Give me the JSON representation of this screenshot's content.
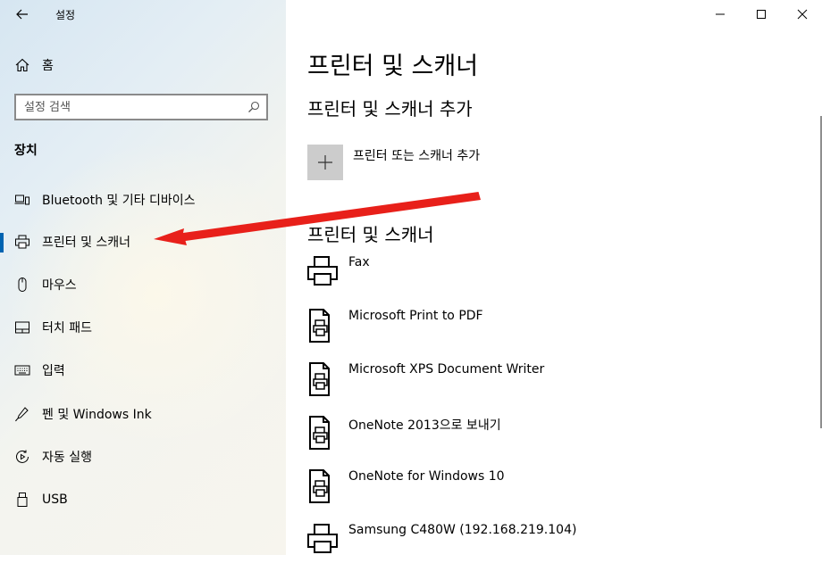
{
  "window": {
    "title": "설정"
  },
  "sidebar": {
    "home_label": "홈",
    "search_placeholder": "설정 검색",
    "section_title": "장치",
    "items": [
      {
        "label": "Bluetooth 및 기타 디바이스",
        "icon": "bluetooth-devices-icon"
      },
      {
        "label": "프린터 및 스캐너",
        "icon": "printer-icon",
        "active": true
      },
      {
        "label": "마우스",
        "icon": "mouse-icon"
      },
      {
        "label": "터치 패드",
        "icon": "touchpad-icon"
      },
      {
        "label": "입력",
        "icon": "keyboard-icon"
      },
      {
        "label": "펜 및 Windows Ink",
        "icon": "pen-icon"
      },
      {
        "label": "자동 실행",
        "icon": "autoplay-icon"
      },
      {
        "label": "USB",
        "icon": "usb-icon"
      }
    ]
  },
  "main": {
    "title": "프린터 및 스캐너",
    "add_section_title": "프린터 및 스캐너 추가",
    "add_button_label": "프린터 또는 스캐너 추가",
    "list_section_title": "프린터 및 스캐너",
    "printers": [
      {
        "name": "Fax",
        "icon": "fax-printer-icon"
      },
      {
        "name": "Microsoft Print to PDF",
        "icon": "document-printer-icon"
      },
      {
        "name": "Microsoft XPS Document Writer",
        "icon": "document-printer-icon"
      },
      {
        "name": "OneNote 2013으로 보내기",
        "icon": "document-printer-icon"
      },
      {
        "name": "OneNote for Windows 10",
        "icon": "document-printer-icon"
      },
      {
        "name": "Samsung C480W (192.168.219.104)",
        "icon": "printer-icon"
      }
    ]
  },
  "annotation": {
    "arrow_color": "#e8201a"
  },
  "colors": {
    "accent": "#0063b1",
    "add_tile": "#cccccc"
  }
}
